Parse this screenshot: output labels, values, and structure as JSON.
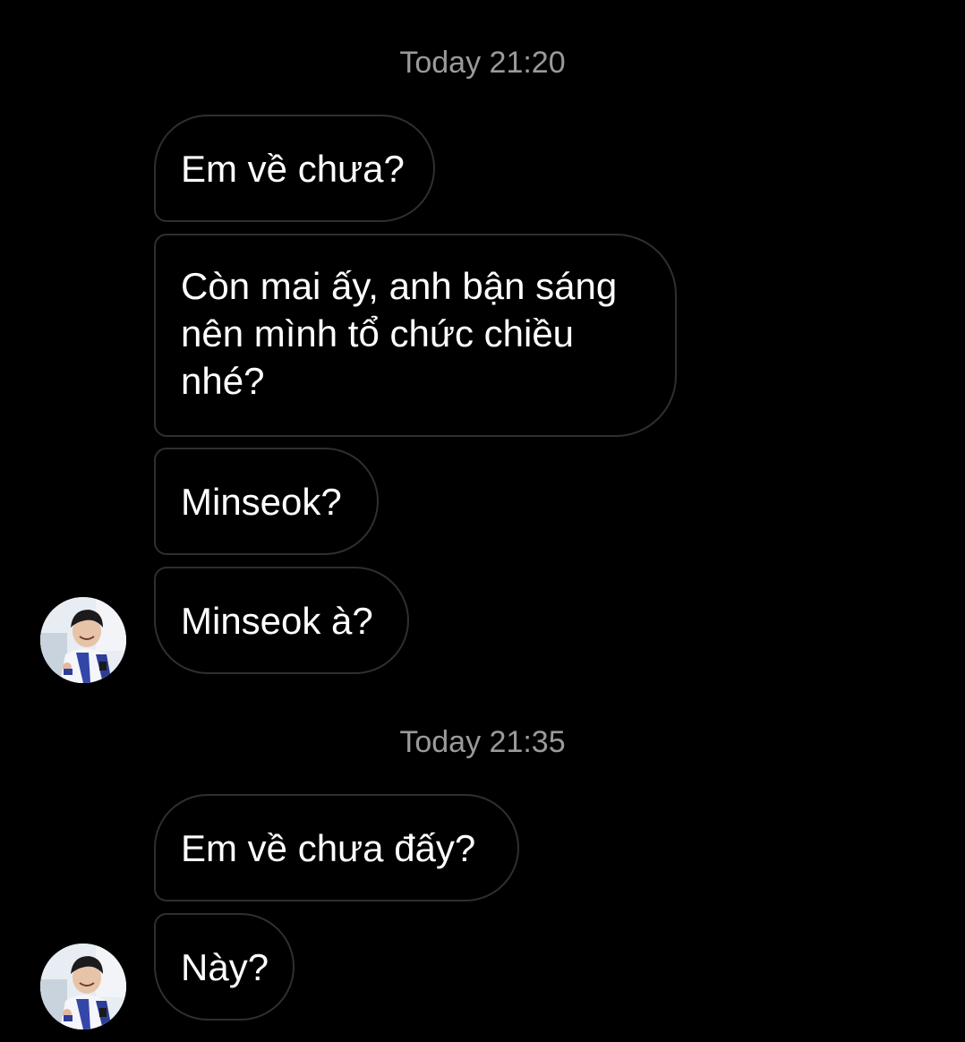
{
  "conversation": {
    "groups": [
      {
        "timestamp": "Today 21:20",
        "messages": [
          "Em về chưa?",
          "Còn mai ấy, anh bận sáng nên mình tổ chức chiều nhé?",
          "Minseok?",
          "Minseok à?"
        ]
      },
      {
        "timestamp": "Today 21:35",
        "messages": [
          "Em về chưa đấy?",
          "Này?"
        ]
      }
    ]
  },
  "colors": {
    "background": "#000000",
    "bubble_border": "#2f2f2f",
    "message_text": "#ffffff",
    "timestamp_text": "#9a9a9a"
  },
  "icons": {
    "sender_avatar": "avatar-photo"
  }
}
